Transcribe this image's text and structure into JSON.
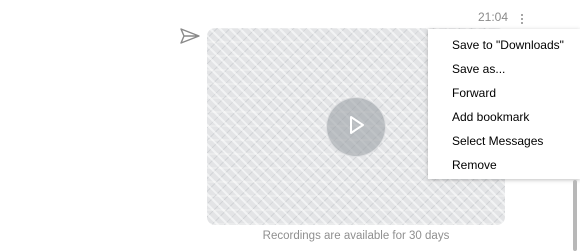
{
  "message": {
    "time": "21:04",
    "caption": "Recordings are available for 30 days",
    "send_icon": "send-arrow-icon",
    "more_icon": "vertical-dots-icon",
    "play_icon": "play-icon"
  },
  "context_menu": {
    "items": [
      {
        "label": "Save to \"Downloads\""
      },
      {
        "label": "Save as..."
      },
      {
        "label": "Forward"
      },
      {
        "label": "Add bookmark"
      },
      {
        "label": "Select Messages"
      },
      {
        "label": "Remove"
      }
    ]
  }
}
